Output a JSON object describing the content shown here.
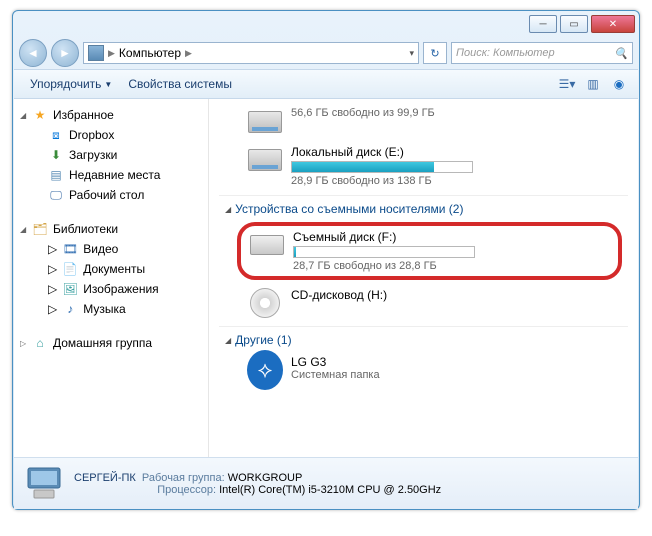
{
  "address": {
    "location": "Компьютер"
  },
  "search": {
    "placeholder": "Поиск: Компьютер"
  },
  "toolbar": {
    "organize": "Упорядочить",
    "props": "Свойства системы"
  },
  "sidebar": {
    "fav": "Избранное",
    "dropbox": "Dropbox",
    "downloads": "Загрузки",
    "recent": "Недавние места",
    "desktop": "Рабочий стол",
    "libs": "Библиотеки",
    "video": "Видео",
    "docs": "Документы",
    "images": "Изображения",
    "music": "Музыка",
    "homegroup": "Домашняя группа"
  },
  "main": {
    "drive_c_free": "56,6 ГБ свободно из 99,9 ГБ",
    "drive_e_name": "Локальный диск (E:)",
    "drive_e_free": "28,9 ГБ свободно из 138 ГБ",
    "drive_e_fill_pct": 79,
    "removable_hdr": "Устройства со съемными носителями (2)",
    "drive_f_name": "Съемный диск (F:)",
    "drive_f_free": "28,7 ГБ свободно из 28,8 ГБ",
    "drive_f_fill_pct": 1,
    "cd_name": "CD-дисковод (H:)",
    "other_hdr": "Другие (1)",
    "lg_name": "LG G3",
    "lg_sub": "Системная папка"
  },
  "details": {
    "pc_name": "СЕРГЕЙ-ПК",
    "wg_label": "Рабочая группа:",
    "wg_value": "WORKGROUP",
    "cpu_label": "Процессор:",
    "cpu_value": "Intel(R) Core(TM) i5-3210M CPU @ 2.50GHz"
  }
}
